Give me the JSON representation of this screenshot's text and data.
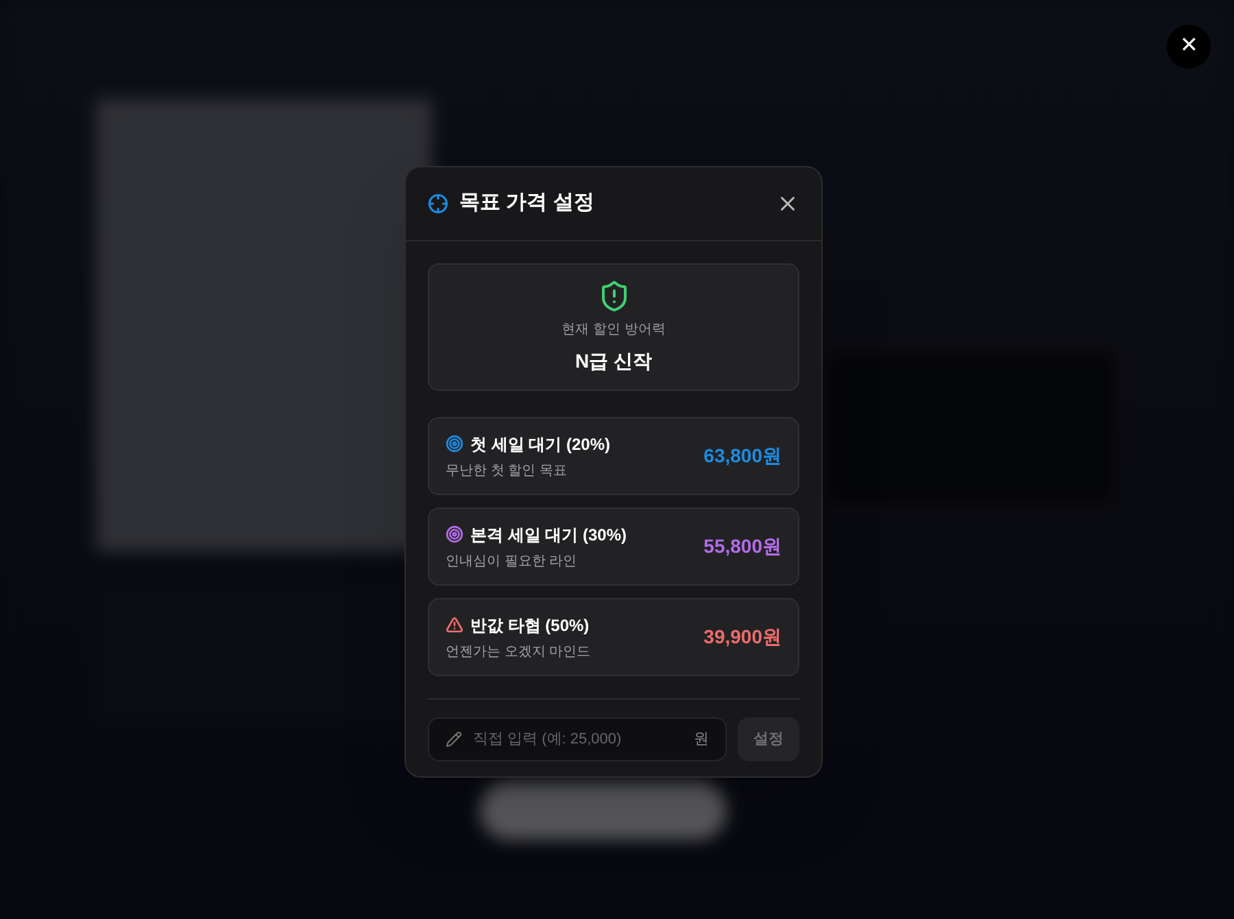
{
  "page_close": {
    "label": "✕"
  },
  "modal": {
    "title": "목표 가격 설정",
    "defense": {
      "label": "현재 할인 방어력",
      "value": "N급 신작"
    },
    "options": [
      {
        "kind": "target",
        "color": "#1d8ce0",
        "title": "첫 세일 대기 (20%)",
        "subtitle": "무난한 첫 할인 목표",
        "price": "63,800원"
      },
      {
        "kind": "target",
        "color": "#b56ce8",
        "title": "본격 세일 대기 (30%)",
        "subtitle": "인내심이 필요한 라인",
        "price": "55,800원"
      },
      {
        "kind": "warning",
        "color": "#ef6b6b",
        "title": "반값 타협 (50%)",
        "subtitle": "언젠가는 오겠지 마인드",
        "price": "39,900원"
      }
    ],
    "input": {
      "placeholder": "직접 입력 (예: 25,000)",
      "unit": "원"
    },
    "submit": {
      "label": "설정"
    }
  }
}
